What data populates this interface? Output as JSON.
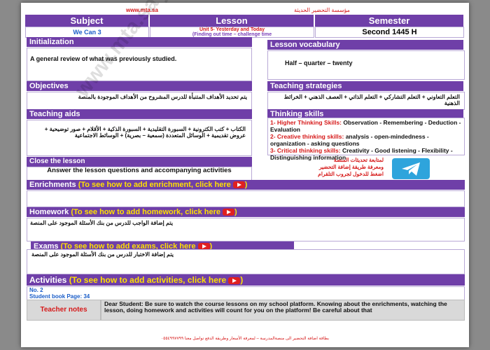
{
  "header": {
    "site": "www.mta.sa",
    "org": "مؤسسة التحضير الحديثة",
    "cols": [
      "Subject",
      "Lesson",
      "Semester"
    ],
    "subject": "We Can 3",
    "lesson_unit": "Unit 5- Yesterday and Today",
    "lesson_title": "(Finding out time – challenge time",
    "semester": "Second 1445 H"
  },
  "sections": {
    "initialization": {
      "title": "Initialization",
      "text": "A general review of what was previously studied."
    },
    "vocabulary": {
      "title": "Lesson vocabulary",
      "text": "Half – quarter – twenty"
    },
    "objectives": {
      "title": "Objectives",
      "text": "يتم تحديد الأهداف المتنبأة للدرس المشروح من الأهداف الموجودة بالمنصة"
    },
    "strategies": {
      "title": "Teaching strategies",
      "text": "التعلم التعاوني + التعلم التشاركي + التعلم الذاتي + العصف الذهني + الخرائط الذهنية"
    },
    "aids": {
      "title": "Teaching aids",
      "text": "الكتاب + كتب الكترونية + السبورة التقليدية + السبورة الذكية + الأقلام + صور توضيحية + عروض تقديمية + الوسائل المتعددة (سمعية – بصرية) + الوسائط الاجتماعية"
    },
    "thinking": {
      "title": "Thinking skills",
      "items": [
        {
          "label": "1- Higher Thinking Skills:",
          "text": " Observation - Remembering - Deduction - Evaluation"
        },
        {
          "label": "2- Creative thinking skills:",
          "text": " analysis - open-mindedness - organization - asking questions"
        },
        {
          "label": "3- Critical thinking skills:",
          "text": " Creativity - Good listening - Flexibility - Distinguishing information"
        }
      ]
    },
    "close": {
      "title": "Close the lesson",
      "text": "Answer the lesson questions and accompanying activities"
    },
    "telegram": {
      "line1": "لمتابعة تحديثات المنصة",
      "line2": "ومعرفة طريقة إضافة التحضير",
      "line3": "اضغط للدخول لجروب التلقرام"
    },
    "enrichments": {
      "title": "Enrichments",
      "link": "(To see how to add enrichment, click here",
      "tail": ")"
    },
    "homework": {
      "title": "Homework",
      "link": "(To see how to add homework, click here",
      "tail": ")",
      "text": "يتم إضافة الواجب للدرس من بنك الأسئلة الموجود على المنصة"
    },
    "exams": {
      "title": "Exams",
      "link": "(To see how to add exams, click here",
      "tail": ")",
      "text": "يتم إضافة الاختبار للدرس من بنك الأسئلة الموجود على المنصة"
    },
    "activities": {
      "title": "Activities",
      "link": "(To see how to add activities, click here",
      "tail": ")",
      "line1": "No. 2",
      "line2": "Student book Page: 34"
    },
    "notes": {
      "title": "Teacher notes",
      "text": "Dear Student: Be sure to watch the course lessons on my school platform. Knowing about the enrichments, watching the lesson, doing homework and activities will count for you on the platform! Be careful about that"
    }
  },
  "footer": "بطاقة اضافة التحضير الى منصةالمدرسة – لمعرفة الأسعار وطريقة الدفع تواصل معنا ٠٥٥٤٩٩٧٧٩٩",
  "watermark": "www.mta.sa تحضير"
}
